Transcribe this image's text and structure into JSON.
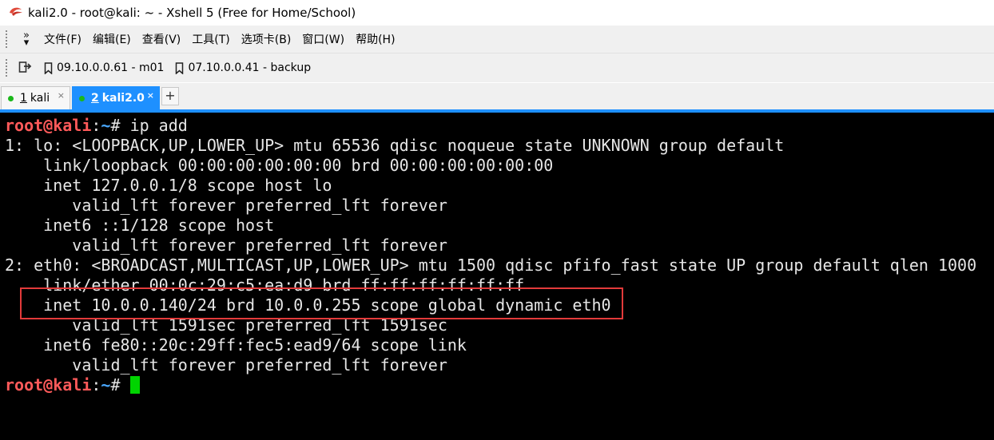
{
  "window": {
    "title": "kali2.0 - root@kali: ~ - Xshell 5 (Free for Home/School)"
  },
  "menubar": {
    "items": [
      "文件(F)",
      "编辑(E)",
      "查看(V)",
      "工具(T)",
      "选项卡(B)",
      "窗口(W)",
      "帮助(H)"
    ]
  },
  "sessions": {
    "bookmarks": [
      "09.10.0.0.61 - m01",
      "07.10.0.0.41 - backup"
    ]
  },
  "tabs": [
    {
      "number": "1",
      "name": "kali",
      "active": false
    },
    {
      "number": "2",
      "name": "kali2.0",
      "active": true
    }
  ],
  "newtab_label": "+",
  "terminal": {
    "prompt_user": "root@kali",
    "prompt_sep": ":",
    "prompt_path": "~",
    "prompt_symbol": "# ",
    "command": "ip add",
    "output": [
      "1: lo: <LOOPBACK,UP,LOWER_UP> mtu 65536 qdisc noqueue state UNKNOWN group default",
      "    link/loopback 00:00:00:00:00:00 brd 00:00:00:00:00:00",
      "    inet 127.0.0.1/8 scope host lo",
      "       valid_lft forever preferred_lft forever",
      "    inet6 ::1/128 scope host",
      "       valid_lft forever preferred_lft forever",
      "2: eth0: <BROADCAST,MULTICAST,UP,LOWER_UP> mtu 1500 qdisc pfifo_fast state UP group default qlen 1000",
      "    link/ether 00:0c:29:c5:ea:d9 brd ff:ff:ff:ff:ff:ff",
      "    inet 10.0.0.140/24 brd 10.0.0.255 scope global dynamic eth0",
      "       valid_lft 1591sec preferred_lft 1591sec",
      "    inet6 fe80::20c:29ff:fec5:ead9/64 scope link",
      "       valid_lft forever preferred_lft forever"
    ]
  },
  "colors": {
    "accent": "#1e90ff",
    "prompt_user": "#ff5a5a",
    "prompt_path": "#4aa8ff",
    "cursor": "#00d400",
    "highlight_box": "#e23a3a"
  }
}
